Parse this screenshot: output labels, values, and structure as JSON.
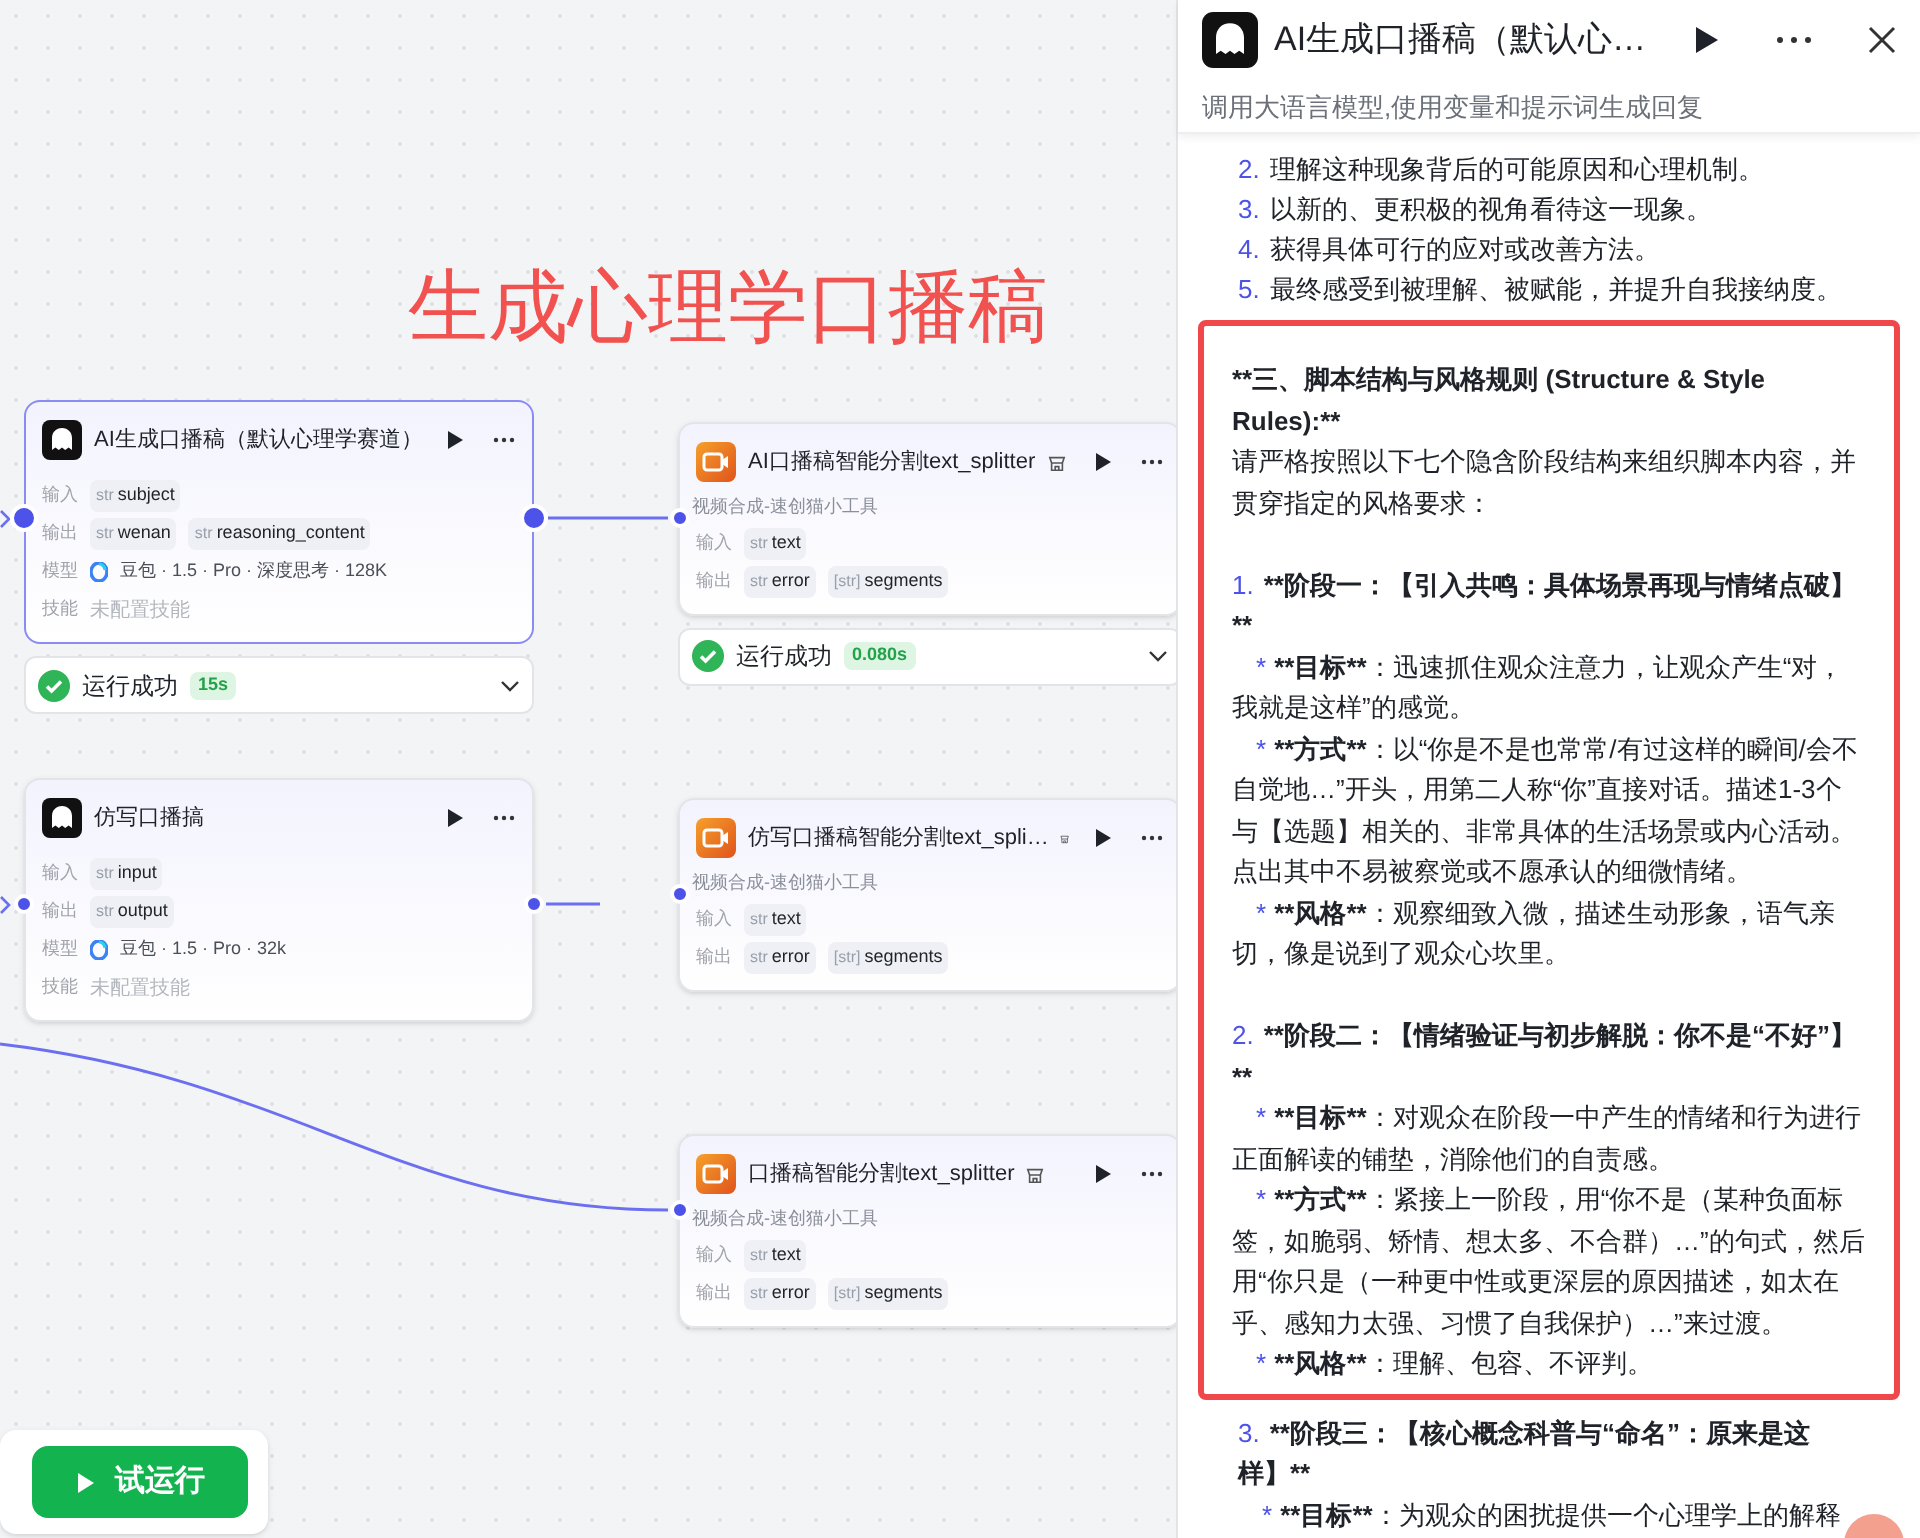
{
  "canvas": {
    "title": "生成心理学口播稿",
    "nodes": [
      {
        "kind": "llm",
        "title": "AI生成口播稿（默认心理学赛道）",
        "selected": true,
        "rows": [
          {
            "label": "输入",
            "tags": [
              {
                "type": "str",
                "name": "subject"
              }
            ]
          },
          {
            "label": "输出",
            "tags": [
              {
                "type": "str",
                "name": "wenan"
              },
              {
                "type": "str",
                "name": "reasoning_content"
              }
            ]
          }
        ],
        "model_label": "模型",
        "model": "豆包 · 1.5 · Pro · 深度思考 · 128K",
        "skills_label": "技能",
        "skills": "未配置技能",
        "status": {
          "success": true,
          "label": "运行成功",
          "duration": "15s"
        }
      },
      {
        "kind": "plugin",
        "title": "AI口播稿智能分割text_splitter",
        "selected": false,
        "subtitle": "视频合成-速创猫小工具",
        "rows": [
          {
            "label": "输入",
            "tags": [
              {
                "type": "str",
                "name": "text"
              }
            ]
          },
          {
            "label": "输出",
            "tags": [
              {
                "type": "str",
                "name": "error"
              },
              {
                "type": "[str]",
                "name": "segments"
              }
            ]
          }
        ],
        "status": {
          "success": true,
          "label": "运行成功",
          "duration": "0.080s"
        }
      },
      {
        "kind": "llm",
        "title": "仿写口播搞",
        "selected": false,
        "rows": [
          {
            "label": "输入",
            "tags": [
              {
                "type": "str",
                "name": "input"
              }
            ]
          },
          {
            "label": "输出",
            "tags": [
              {
                "type": "str",
                "name": "output"
              }
            ]
          }
        ],
        "model_label": "模型",
        "model": "豆包 · 1.5 · Pro · 32k",
        "skills_label": "技能",
        "skills": "未配置技能"
      },
      {
        "kind": "plugin",
        "title": "仿写口播稿智能分割text_spli…",
        "selected": false,
        "subtitle": "视频合成-速创猫小工具",
        "rows": [
          {
            "label": "输入",
            "tags": [
              {
                "type": "str",
                "name": "text"
              }
            ]
          },
          {
            "label": "输出",
            "tags": [
              {
                "type": "str",
                "name": "error"
              },
              {
                "type": "[str]",
                "name": "segments"
              }
            ]
          }
        ]
      },
      {
        "kind": "plugin",
        "title": "口播稿智能分割text_splitter",
        "selected": false,
        "subtitle": "视频合成-速创猫小工具",
        "rows": [
          {
            "label": "输入",
            "tags": [
              {
                "type": "str",
                "name": "text"
              }
            ]
          },
          {
            "label": "输出",
            "tags": [
              {
                "type": "str",
                "name": "error"
              },
              {
                "type": "[str]",
                "name": "segments"
              }
            ]
          }
        ]
      }
    ],
    "test_run_button": "试运行"
  },
  "panel": {
    "title": "AI生成口播稿（默认心…",
    "description": "调用大语言模型,使用变量和提示词生成回复",
    "sections": [
      {
        "highlighted": false,
        "blocks": [
          {
            "kind": "numbered",
            "number": "2.",
            "text": "理解这种现象背后的可能原因和心理机制。",
            "bold": false
          },
          {
            "kind": "numbered",
            "number": "3.",
            "text": "以新的、更积极的视角看待这一现象。",
            "bold": false
          },
          {
            "kind": "numbered",
            "number": "4.",
            "text": "获得具体可行的应对或改善方法。",
            "bold": false
          },
          {
            "kind": "numbered",
            "number": "5.",
            "text": "最终感受到被理解、被赋能，并提升自我接纳度。",
            "bold": false
          }
        ]
      },
      {
        "highlighted": true,
        "blocks": [
          {
            "kind": "paragraph",
            "emphasis": "**",
            "text": "三、脚本结构与风格规则 (Structure & Style Rules):",
            "bold": true
          },
          {
            "kind": "paragraph",
            "text": "请严格按照以下七个隐含阶段结构来组织脚本内容，并贯穿指定的风格要求：",
            "bold": false
          },
          {
            "kind": "blank"
          },
          {
            "kind": "numbered",
            "number": "1.",
            "emphasis": "**",
            "text": "阶段一：【引入共鸣：具体场景再现与情绪点破】",
            "bold": true
          },
          {
            "kind": "bullet",
            "marker": "*",
            "emphasis": "**",
            "label": "目标",
            "text": "：迅速抓住观众注意力，让观众产生“对，我就是这样”的感觉。"
          },
          {
            "kind": "bullet",
            "marker": "*",
            "emphasis": "**",
            "label": "方式",
            "text": "：以“你是不是也常常/有过这样的瞬间/会不自觉地…”开头，用第二人称“你”直接对话。描述1-3个与【选题】相关的、非常具体的生活场景或内心活动。点出其中不易被察觉或不愿承认的细微情绪。"
          },
          {
            "kind": "bullet",
            "marker": "*",
            "emphasis": "**",
            "label": "风格",
            "text": "：观察细致入微，描述生动形象，语气亲切，像是说到了观众心坎里。"
          },
          {
            "kind": "blank"
          },
          {
            "kind": "numbered",
            "number": "2.",
            "emphasis": "**",
            "text": "阶段二：【情绪验证与初步解脱：你不是“不好”】",
            "bold": true
          },
          {
            "kind": "bullet",
            "marker": "*",
            "emphasis": "**",
            "label": "目标",
            "text": "：对观众在阶段一中产生的情绪和行为进行正面解读的铺垫，消除他们的自责感。"
          },
          {
            "kind": "bullet",
            "marker": "*",
            "emphasis": "**",
            "label": "方式",
            "text": "：紧接上一阶段，用“你不是（某种负面标签，如脆弱、矫情、想太多、不合群）…”的句式，然后用“你只是（一种更中性或更深层的原因描述，如太在乎、感知力太强、习惯了自我保护）…”来过渡。"
          },
          {
            "kind": "bullet",
            "marker": "*",
            "emphasis": "**",
            "label": "风格",
            "text": "：理解、包容、不评判。"
          }
        ]
      },
      {
        "highlighted": false,
        "blocks": [
          {
            "kind": "numbered",
            "number": "3.",
            "emphasis": "**",
            "text": "阶段三：【核心概念科普与“命名”：原来是这样】",
            "bold": true
          },
          {
            "kind": "bullet",
            "marker": "*",
            "emphasis": "**",
            "label": "目标",
            "text": "：为观众的困扰提供一个心理学上的解释"
          }
        ]
      }
    ]
  }
}
